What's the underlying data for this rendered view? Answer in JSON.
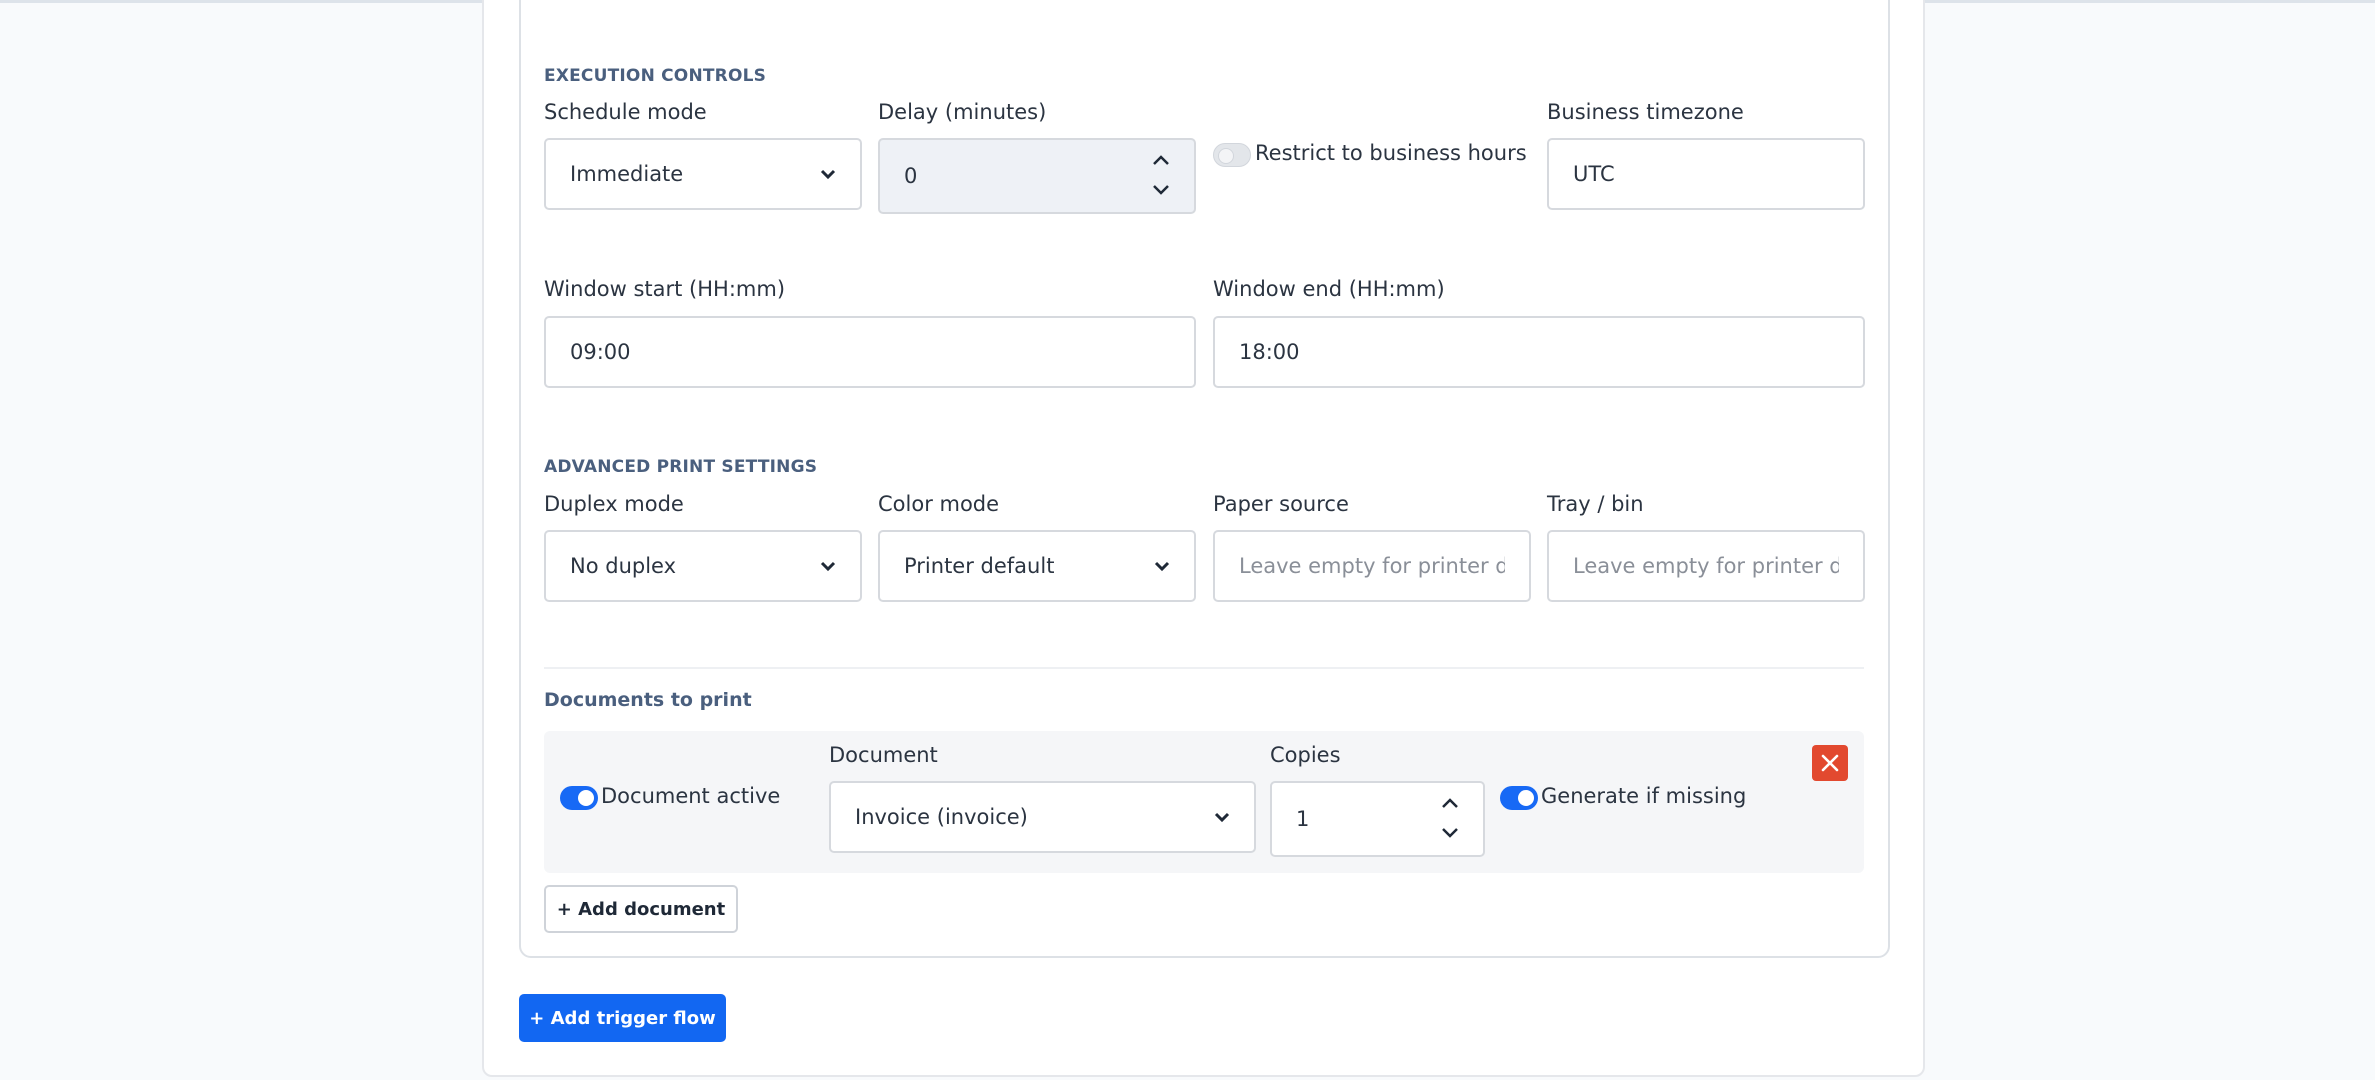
{
  "execution_controls": {
    "section_title": "EXECUTION CONTROLS",
    "schedule_mode": {
      "label": "Schedule mode",
      "value": "Immediate"
    },
    "delay": {
      "label": "Delay (minutes)",
      "value": "0"
    },
    "business_hours_toggle": {
      "label": "Restrict to business hours",
      "checked": false
    },
    "business_timezone": {
      "label": "Business timezone",
      "value": "UTC"
    },
    "window_start": {
      "label": "Window start (HH:mm)",
      "value": "09:00"
    },
    "window_end": {
      "label": "Window end (HH:mm)",
      "value": "18:00"
    }
  },
  "advanced_print": {
    "section_title": "ADVANCED PRINT SETTINGS",
    "duplex_mode": {
      "label": "Duplex mode",
      "value": "No duplex"
    },
    "color_mode": {
      "label": "Color mode",
      "value": "Printer default"
    },
    "paper_source": {
      "label": "Paper source",
      "placeholder": "Leave empty for printer de"
    },
    "tray_bin": {
      "label": "Tray / bin",
      "placeholder": "Leave empty for printer de"
    }
  },
  "documents": {
    "title": "Documents to print",
    "items": [
      {
        "active_label": "Document active",
        "active": true,
        "document_label": "Document",
        "document_value": "Invoice (invoice)",
        "copies_label": "Copies",
        "copies_value": "1",
        "generate_label": "Generate if missing",
        "generate": true
      }
    ],
    "add_label": "+ Add document"
  },
  "add_trigger_flow_label": "+ Add trigger flow",
  "colors": {
    "primary": "#1267f2",
    "danger": "#e2492f",
    "section_title": "#4a5f7e"
  }
}
